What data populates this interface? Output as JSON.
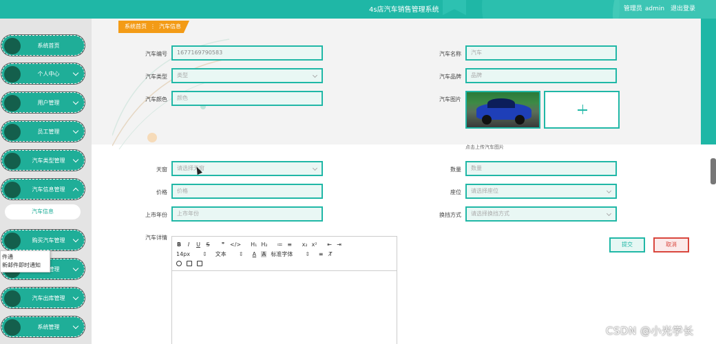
{
  "header": {
    "title": "4s店汽车销售管理系统",
    "user_prefix": "管理员",
    "username": "admin",
    "logout": "退出登录",
    "color": "#1fb7a6"
  },
  "sidebar": {
    "items": [
      {
        "label": "系统首页",
        "expand": ""
      },
      {
        "label": "个人中心",
        "expand": "down"
      },
      {
        "label": "用户管理",
        "expand": "down"
      },
      {
        "label": "员工管理",
        "expand": "down"
      },
      {
        "label": "汽车类型管理",
        "expand": "down"
      },
      {
        "label": "汽车信息管理",
        "expand": "up"
      },
      {
        "label": "购买汽车管理",
        "expand": "down"
      },
      {
        "label": "退车管理",
        "expand": "down"
      },
      {
        "label": "汽车出库管理",
        "expand": "down"
      },
      {
        "label": "系统管理",
        "expand": "down"
      }
    ],
    "sub_item": "汽车信息"
  },
  "mail_popup": {
    "line1": "件通",
    "line2": "新邮件即时通知"
  },
  "breadcrumb": {
    "home": "系统首页",
    "separator": "⋮",
    "current": "汽车信息",
    "color": "#f39b16"
  },
  "form": {
    "car_no": {
      "label": "汽车编号",
      "value": "1677169790583"
    },
    "car_name": {
      "label": "汽车名称",
      "placeholder": "汽车"
    },
    "car_type": {
      "label": "汽车类型",
      "placeholder": "类型"
    },
    "car_brand": {
      "label": "汽车品牌",
      "placeholder": "品牌"
    },
    "car_color": {
      "label": "汽车颜色",
      "placeholder": "颜色"
    },
    "car_image": {
      "label": "汽车图片",
      "hint": "点击上传汽车图片",
      "upload_icon": "plus-icon"
    },
    "sunroof": {
      "label": "天窗",
      "placeholder": "请选择天窗"
    },
    "quantity": {
      "label": "数量",
      "placeholder": "数量"
    },
    "price": {
      "label": "价格",
      "placeholder": "价格"
    },
    "seats": {
      "label": "座位",
      "placeholder": "请选择座位"
    },
    "launch_year": {
      "label": "上市年份",
      "placeholder": "上市年份"
    },
    "gear": {
      "label": "换挡方式",
      "placeholder": "请选择换挡方式"
    },
    "details": {
      "label": "汽车详情"
    }
  },
  "editor": {
    "row1": [
      "B",
      "I",
      "U",
      "S",
      "❞",
      "</>",
      "H₁",
      "H₂",
      "≔",
      "≡",
      "x₂",
      "x²",
      "⇤",
      "⇥"
    ],
    "font_size": "14px",
    "block_type": "文本",
    "text_color": "A",
    "bg_color": "A",
    "font_family": "标准字体",
    "align": "≡",
    "clear": "T̸"
  },
  "buttons": {
    "submit": "提交",
    "cancel": "取消",
    "submit_color": "#1fb7a6",
    "cancel_color": "#d9453c"
  },
  "watermark": "CSDN @小光学长"
}
